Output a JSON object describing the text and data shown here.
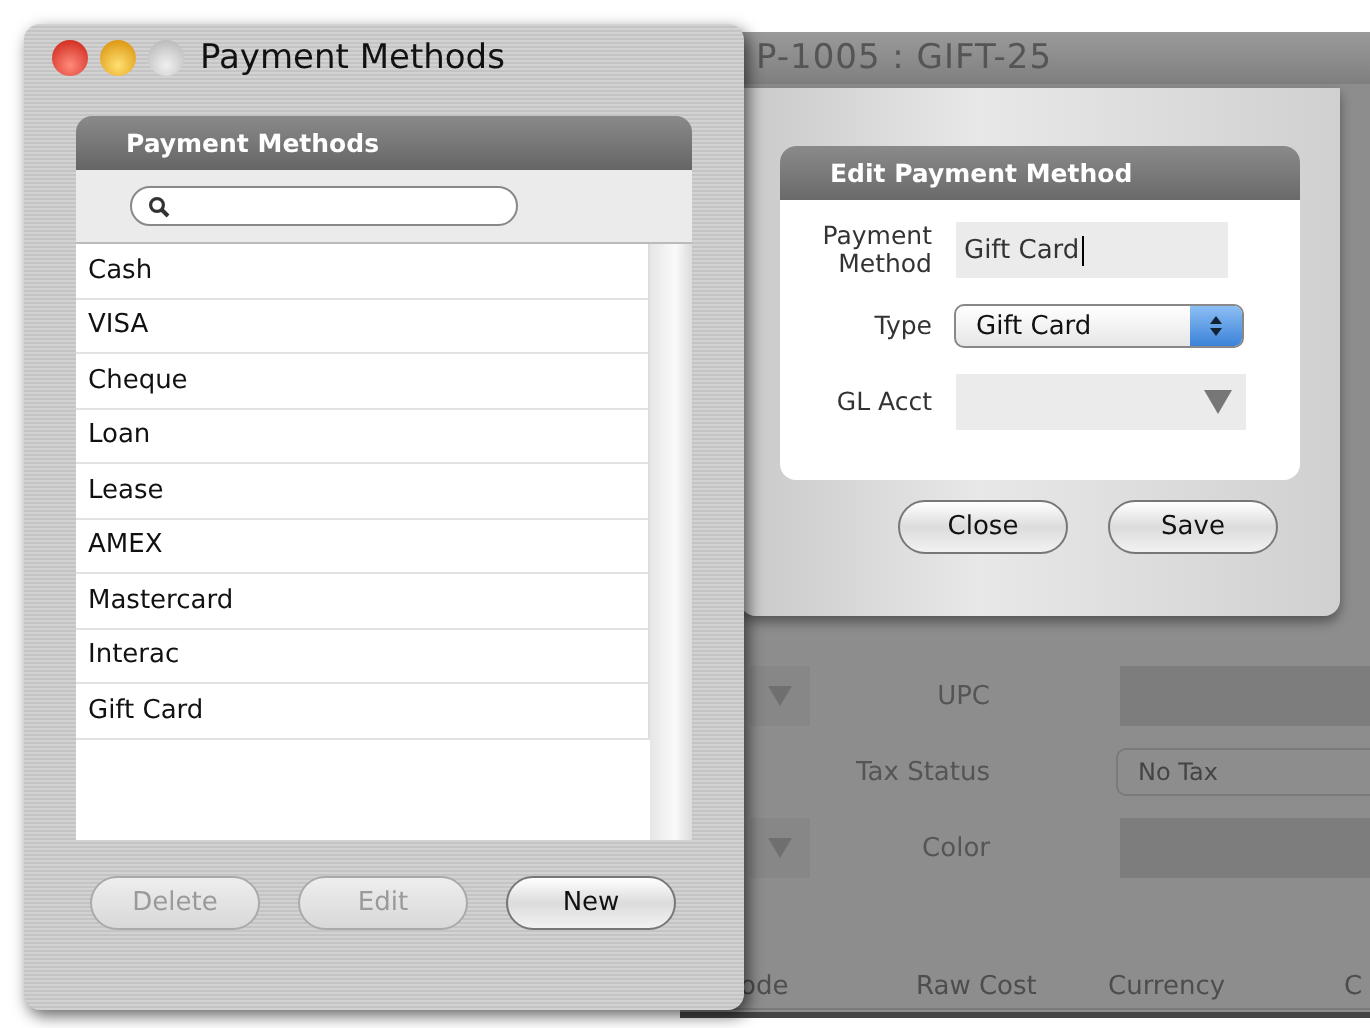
{
  "back_window": {
    "title": "P-1005 : GIFT-25",
    "rows": [
      {
        "kind": "dropdown",
        "label": "UPC"
      },
      {
        "kind": "popup",
        "label": "Tax Status",
        "value": "No Tax"
      },
      {
        "kind": "dropdown",
        "label": "Color"
      }
    ],
    "columns": [
      "ode",
      "Raw Cost",
      "Currency",
      "C"
    ]
  },
  "window": {
    "title": "Payment Methods"
  },
  "panel": {
    "title": "Payment Methods",
    "items": [
      "Cash",
      "VISA",
      "Cheque",
      "Loan",
      "Lease",
      "AMEX",
      "Mastercard",
      "Interac",
      "Gift Card"
    ]
  },
  "buttons": [
    {
      "label": "Delete",
      "disabled": true
    },
    {
      "label": "Edit",
      "disabled": true
    },
    {
      "label": "New",
      "disabled": false
    }
  ],
  "sheet": {
    "title": "Edit Payment Method",
    "fields": [
      {
        "kind": "text",
        "label": "Payment Method",
        "value": "Gift Card",
        "focused": true
      },
      {
        "kind": "popup",
        "label": "Type",
        "value": "Gift Card"
      },
      {
        "kind": "combo",
        "label": "GL Acct"
      }
    ],
    "buttons": [
      "Close",
      "Save"
    ]
  }
}
